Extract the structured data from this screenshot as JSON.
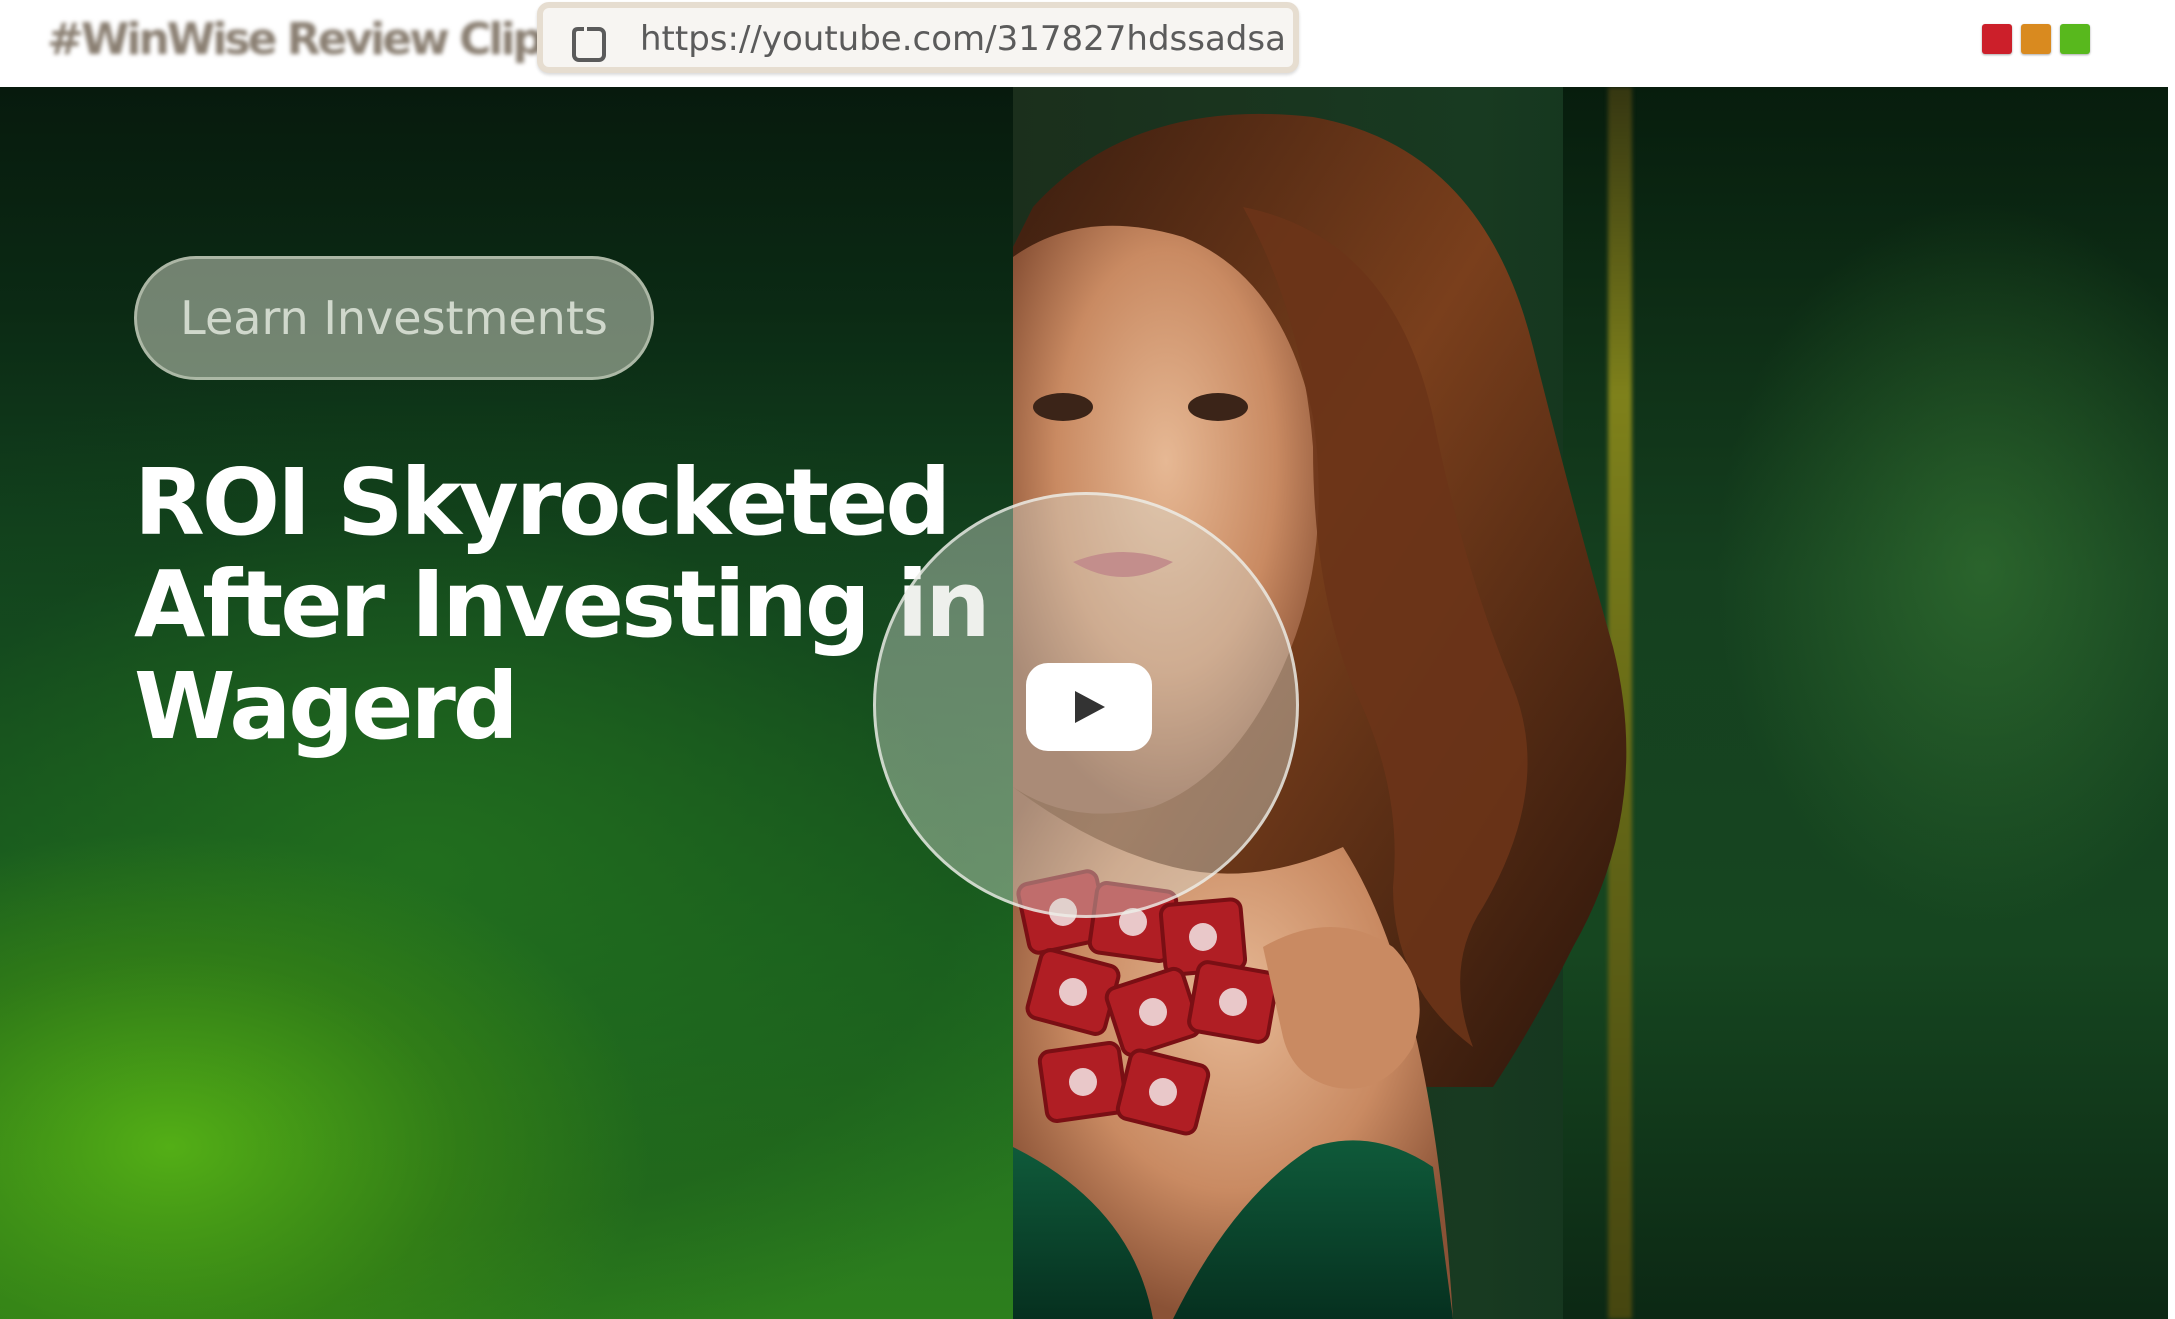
{
  "window": {
    "title": "#WinWise Review Clip",
    "controls": [
      {
        "name": "close",
        "color": "#cc1f2a"
      },
      {
        "name": "minimize",
        "color": "#d98a1f"
      },
      {
        "name": "maximize",
        "color": "#58b81d"
      }
    ]
  },
  "address_bar": {
    "url": "https://youtube.com/317827hdssadsa"
  },
  "video": {
    "cta_label": "Learn Investments",
    "headline": {
      "line1": "ROI Skyrocketed",
      "line2": "After Investing in",
      "line3": "Wagerd"
    },
    "play_icon": "play-icon"
  },
  "colors": {
    "accent_green": "#2d7f1d",
    "headline_text": "#ffffff"
  }
}
